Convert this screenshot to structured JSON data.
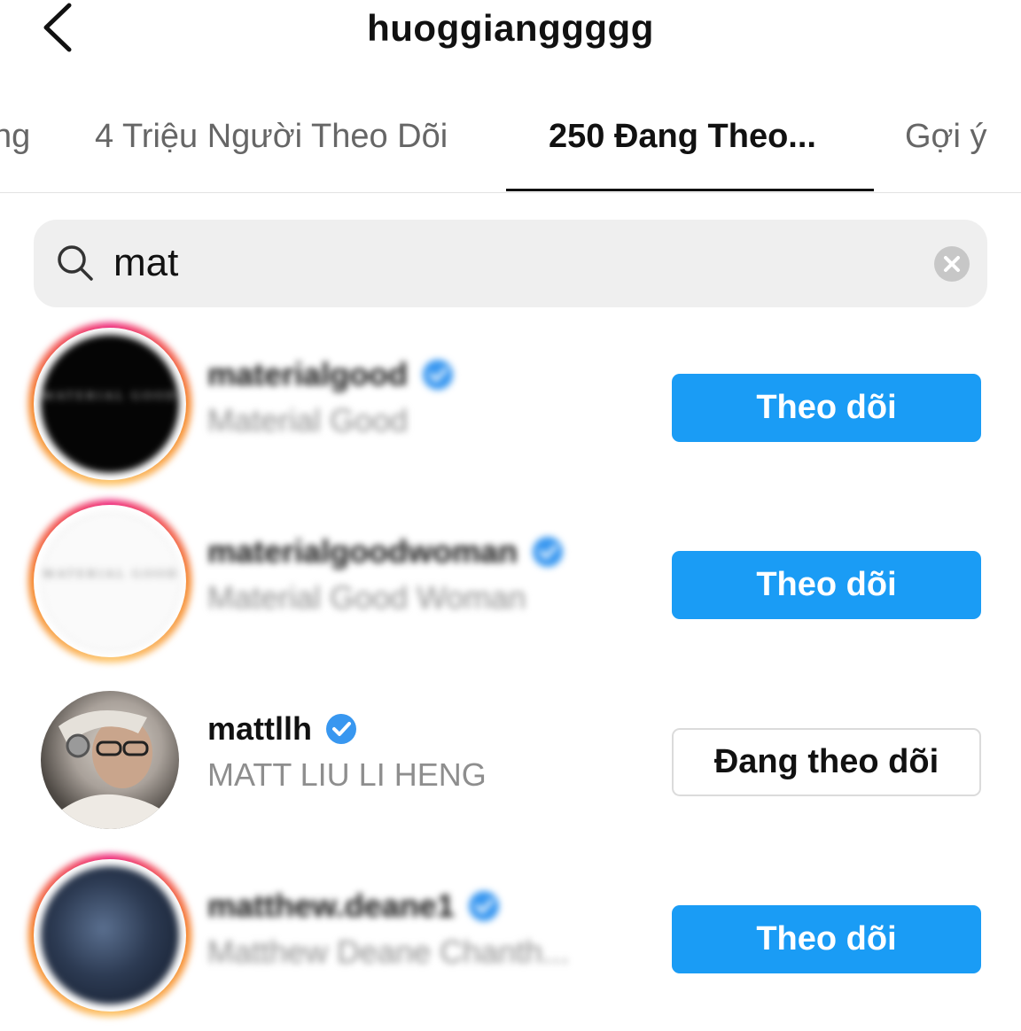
{
  "header": {
    "title": "huoggianggggg"
  },
  "tabs": [
    {
      "label": "ng"
    },
    {
      "label": "4 Triệu Người Theo Dõi"
    },
    {
      "label": "250 Đang Theo..."
    },
    {
      "label": "Gợi ý"
    }
  ],
  "search": {
    "value": "mat"
  },
  "results": [
    {
      "username": "materialgood",
      "fullname": "Material Good",
      "button": "Theo dõi",
      "avatar_text": "MATERIAL GOOD"
    },
    {
      "username": "materialgoodwoman",
      "fullname": "Material Good Woman",
      "button": "Theo dõi",
      "avatar_text": "MATERIAL GOOD"
    },
    {
      "username": "mattllh",
      "fullname": "MATT LIU LI HENG",
      "button": "Đang theo dõi"
    },
    {
      "username": "matthew.deane1",
      "fullname": "Matthew Deane Chanth...",
      "button": "Theo dõi"
    }
  ],
  "colors": {
    "follow_blue": "#1a9cf5",
    "verified_blue": "#3897f0"
  }
}
